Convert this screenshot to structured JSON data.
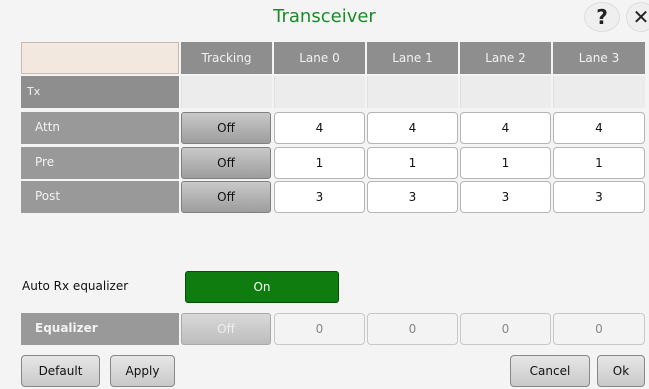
{
  "title": "Transceiver",
  "help_glyph": "?",
  "close_glyph": "✕",
  "columns": [
    "Tracking",
    "Lane 0",
    "Lane 1",
    "Lane 2",
    "Lane 3"
  ],
  "tx_label": "Tx",
  "rows": [
    {
      "label": "Attn",
      "tracking": "Off",
      "lanes": [
        "4",
        "4",
        "4",
        "4"
      ]
    },
    {
      "label": "Pre",
      "tracking": "Off",
      "lanes": [
        "1",
        "1",
        "1",
        "1"
      ]
    },
    {
      "label": "Post",
      "tracking": "Off",
      "lanes": [
        "3",
        "3",
        "3",
        "3"
      ]
    }
  ],
  "auto_rx": {
    "label": "Auto Rx equalizer",
    "value": "On"
  },
  "equalizer": {
    "label": "Equalizer",
    "tracking": "Off",
    "lanes": [
      "0",
      "0",
      "0",
      "0"
    ]
  },
  "buttons": {
    "default": "Default",
    "apply": "Apply",
    "cancel": "Cancel",
    "ok": "Ok"
  },
  "colors": {
    "title": "#1b8a2a",
    "on_button": "#0e7c0e"
  }
}
